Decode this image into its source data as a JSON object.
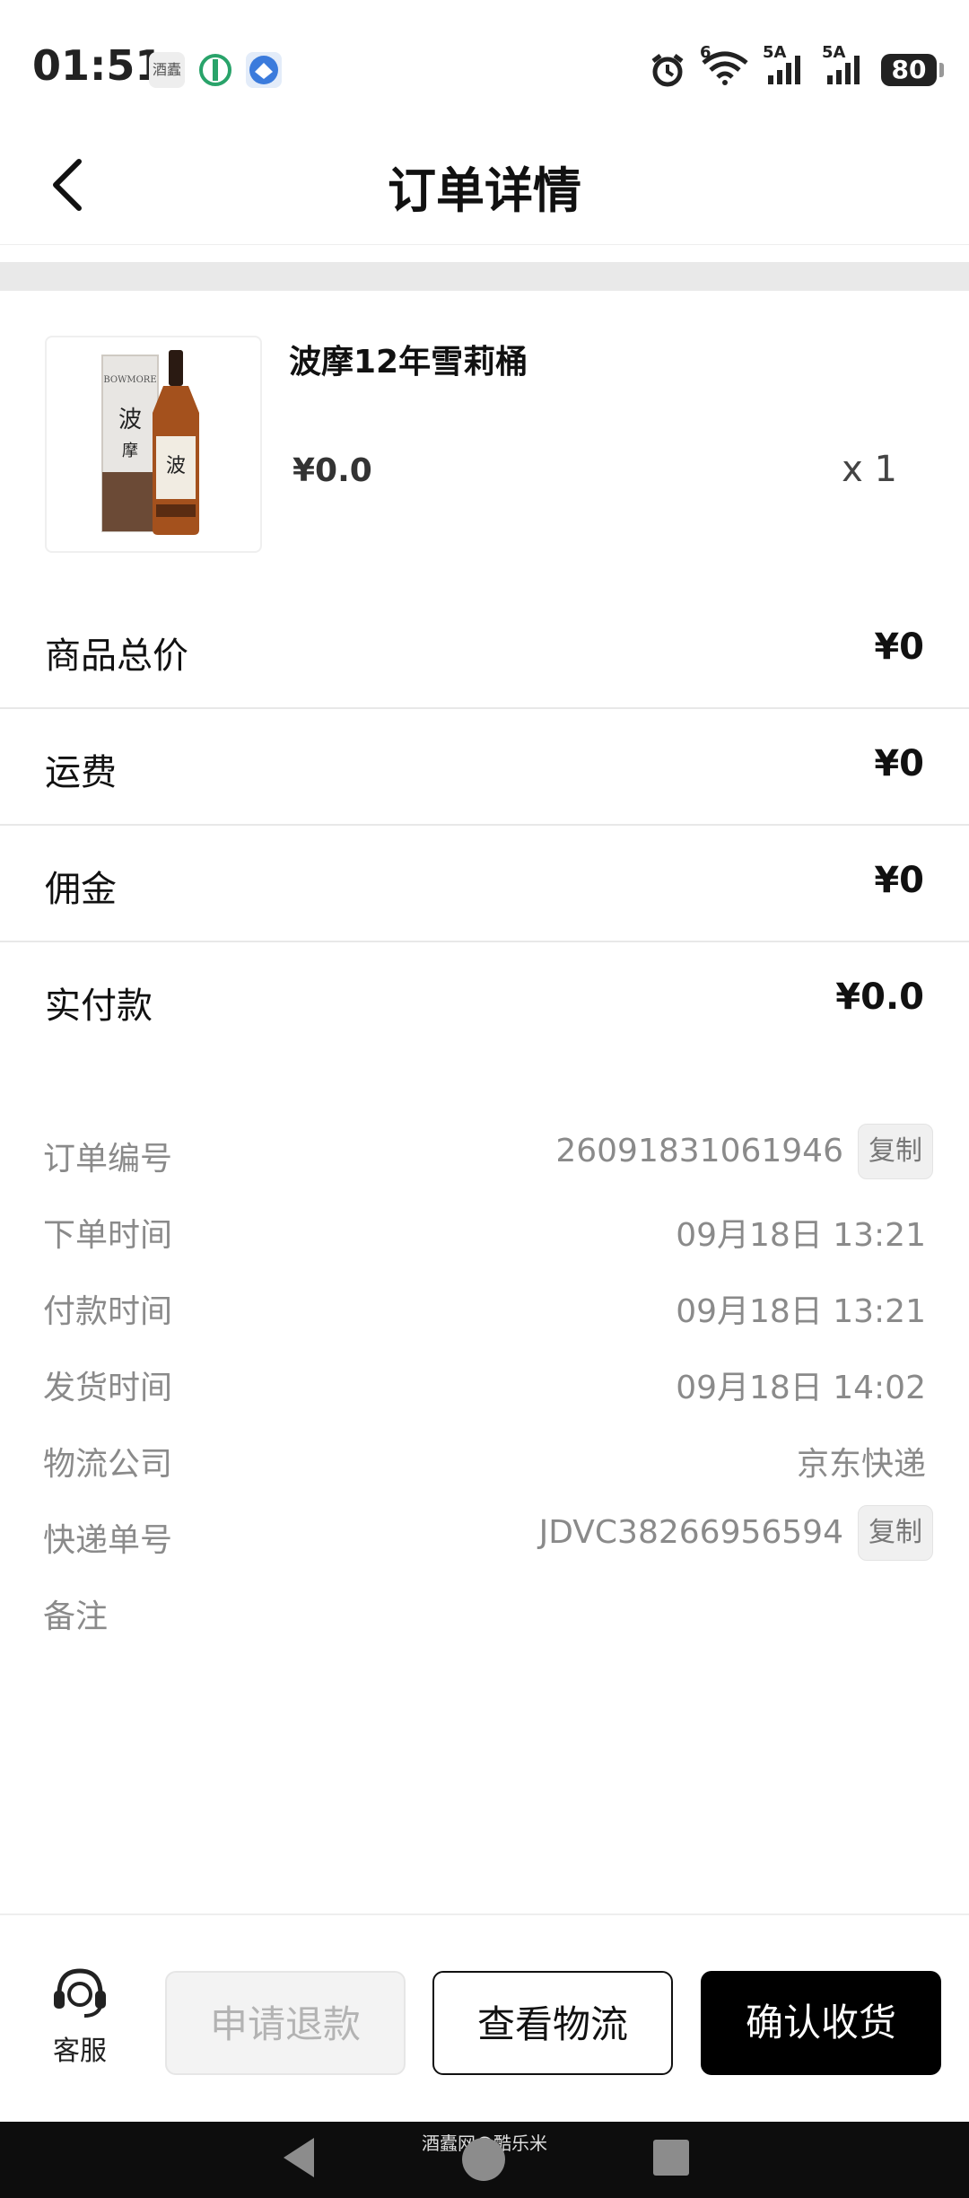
{
  "status_bar": {
    "time": "01:51",
    "app_icon_1_text": "酒蠹",
    "network_1": "6",
    "network_2": "5A",
    "network_3": "5A",
    "battery": "80"
  },
  "header": {
    "title": "订单详情",
    "back_icon": "chevron-left-icon"
  },
  "product": {
    "name": "波摩12年雪莉桶",
    "price": "¥0.0",
    "quantity": "x 1"
  },
  "prices": [
    {
      "label": "商品总价",
      "value": "¥0"
    },
    {
      "label": "运费",
      "value": "¥0"
    },
    {
      "label": "佣金",
      "value": "¥0"
    },
    {
      "label": "实付款",
      "value": "¥0.0"
    }
  ],
  "info": {
    "order_no_label": "订单编号",
    "order_no": "26091831061946",
    "order_time_label": "下单时间",
    "order_time": "09月18日 13:21",
    "pay_time_label": "付款时间",
    "pay_time": "09月18日 13:21",
    "ship_time_label": "发货时间",
    "ship_time": "09月18日 14:02",
    "carrier_label": "物流公司",
    "carrier": "京东快递",
    "tracking_label": "快递单号",
    "tracking_no": "JDVC38266956594",
    "remark_label": "备注",
    "copy_label": "复制"
  },
  "bottom_bar": {
    "service_label": "客服",
    "refund_label": "申请退款",
    "logistics_label": "查看物流",
    "confirm_label": "确认收货"
  },
  "nav_bar": {
    "watermark": "酒蠹网@酷乐米"
  },
  "colors": {
    "primary": "#000000",
    "muted_text": "#8a8a8a",
    "disabled_button": "#f3f3f3"
  }
}
